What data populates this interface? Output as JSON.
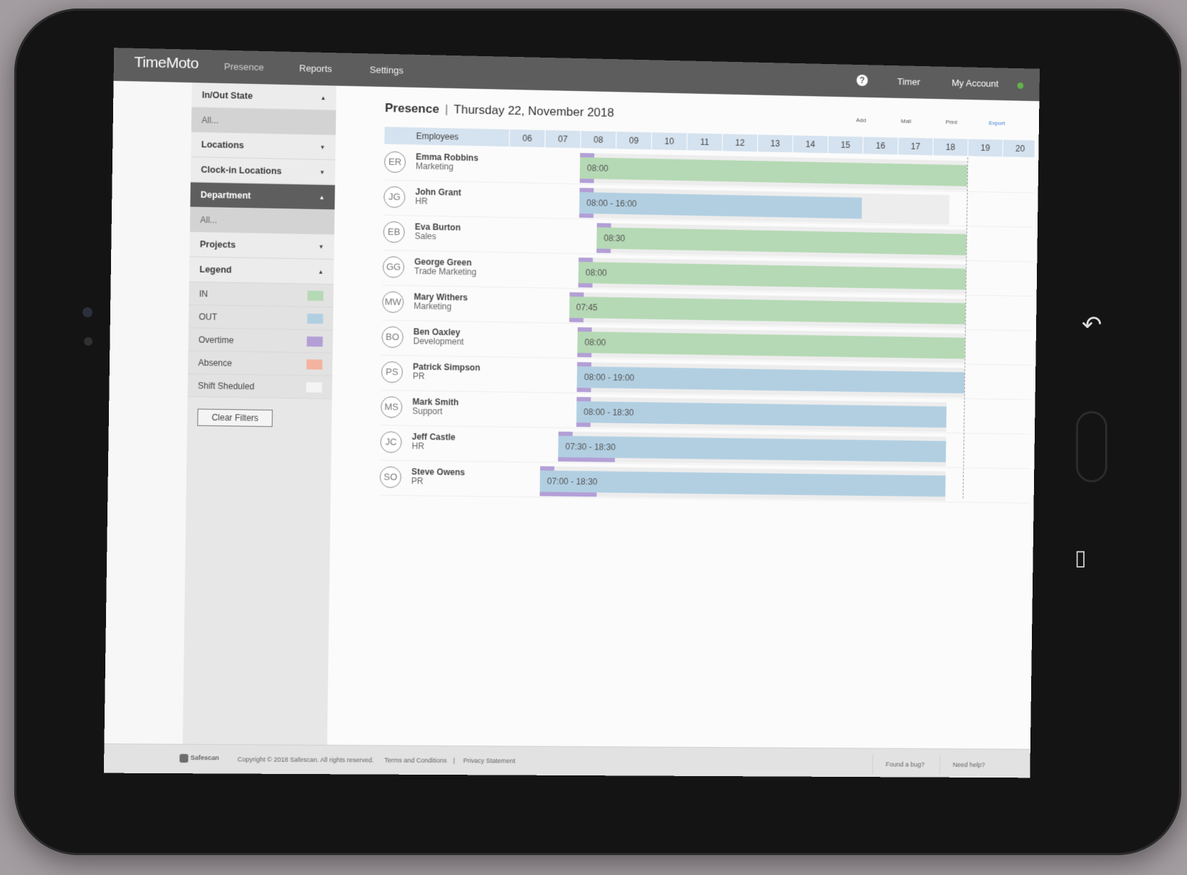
{
  "app": {
    "logo": "TimeMoto"
  },
  "nav": [
    {
      "label": "Presence"
    },
    {
      "label": "Reports"
    },
    {
      "label": "Settings"
    }
  ],
  "header_right": {
    "help": "?",
    "timer": "Timer",
    "account": "My Account"
  },
  "sidebar": {
    "in_out_state": "In/Out State",
    "in_out_value": "All...",
    "locations": "Locations",
    "clockin_locations": "Clock-in Locations",
    "department": "Department",
    "department_value": "All...",
    "projects": "Projects",
    "legend_title": "Legend",
    "legend": [
      {
        "label": "IN",
        "color": "#b5d9b4"
      },
      {
        "label": "OUT",
        "color": "#b2cfe2"
      },
      {
        "label": "Overtime",
        "color": "#b39fd6"
      },
      {
        "label": "Absence",
        "color": "#f4b39e"
      },
      {
        "label": "Shift Sheduled",
        "color": "#f4f4f4"
      }
    ],
    "clear_filters": "Clear Filters"
  },
  "page": {
    "title": "Presence",
    "separator": "|",
    "date": "Thursday 22, November 2018",
    "actions": {
      "add": "Add",
      "mail": "Mail",
      "print": "Print",
      "export": "Export"
    }
  },
  "grid": {
    "employees_header": "Employees",
    "hours": [
      "06",
      "07",
      "08",
      "09",
      "10",
      "11",
      "12",
      "13",
      "14",
      "15",
      "16",
      "17",
      "18",
      "19",
      "20"
    ],
    "rows": [
      {
        "initials": "ER",
        "name": "Emma Robbins",
        "dept": "Marketing",
        "status": "in",
        "label": "08:00",
        "start": 8.0,
        "end": 19.0,
        "shift_start": 8.0,
        "shift_end": 19.0
      },
      {
        "initials": "JG",
        "name": "John Grant",
        "dept": "HR",
        "status": "out",
        "label": "08:00 - 16:00",
        "start": 8.0,
        "end": 16.0,
        "shift_start": 8.0,
        "shift_end": 18.5
      },
      {
        "initials": "EB",
        "name": "Eva Burton",
        "dept": "Sales",
        "status": "in",
        "label": "08:30",
        "start": 8.5,
        "end": 19.0,
        "shift_start": 8.5,
        "shift_end": 19.0
      },
      {
        "initials": "GG",
        "name": "George Green",
        "dept": "Trade Marketing",
        "status": "in",
        "label": "08:00",
        "start": 8.0,
        "end": 19.0,
        "shift_start": 8.0,
        "shift_end": 19.0
      },
      {
        "initials": "MW",
        "name": "Mary Withers",
        "dept": "Marketing",
        "status": "in",
        "label": "07:45",
        "start": 7.75,
        "end": 19.0,
        "shift_start": 7.75,
        "shift_end": 19.0
      },
      {
        "initials": "BO",
        "name": "Ben Oaxley",
        "dept": "Development",
        "status": "in",
        "label": "08:00",
        "start": 8.0,
        "end": 19.0,
        "shift_start": 8.0,
        "shift_end": 19.0
      },
      {
        "initials": "PS",
        "name": "Patrick Simpson",
        "dept": "PR",
        "status": "out",
        "label": "08:00 - 19:00",
        "start": 8.0,
        "end": 19.0,
        "shift_start": 8.0,
        "shift_end": 19.0
      },
      {
        "initials": "MS",
        "name": "Mark Smith",
        "dept": "Support",
        "status": "out",
        "label": "08:00 - 18:30",
        "start": 8.0,
        "end": 18.5,
        "shift_start": 8.0,
        "shift_end": 18.5
      },
      {
        "initials": "JC",
        "name": "Jeff Castle",
        "dept": "HR",
        "status": "out",
        "label": "07:30 - 18:30",
        "start": 7.5,
        "end": 18.5,
        "shift_start": 7.5,
        "shift_end": 18.5
      },
      {
        "initials": "SO",
        "name": "Steve Owens",
        "dept": "PR",
        "status": "out",
        "label": "07:00 - 18:30",
        "start": 7.0,
        "end": 18.5,
        "shift_start": 7.0,
        "shift_end": 18.5
      }
    ]
  },
  "footer": {
    "brand": "Safescan",
    "copyright": "Copyright © 2018 Safescan. All rights reserved.",
    "terms": "Terms and Conditions",
    "divider": "|",
    "privacy": "Privacy Statement",
    "bug": "Found a bug?",
    "help": "Need help?"
  }
}
